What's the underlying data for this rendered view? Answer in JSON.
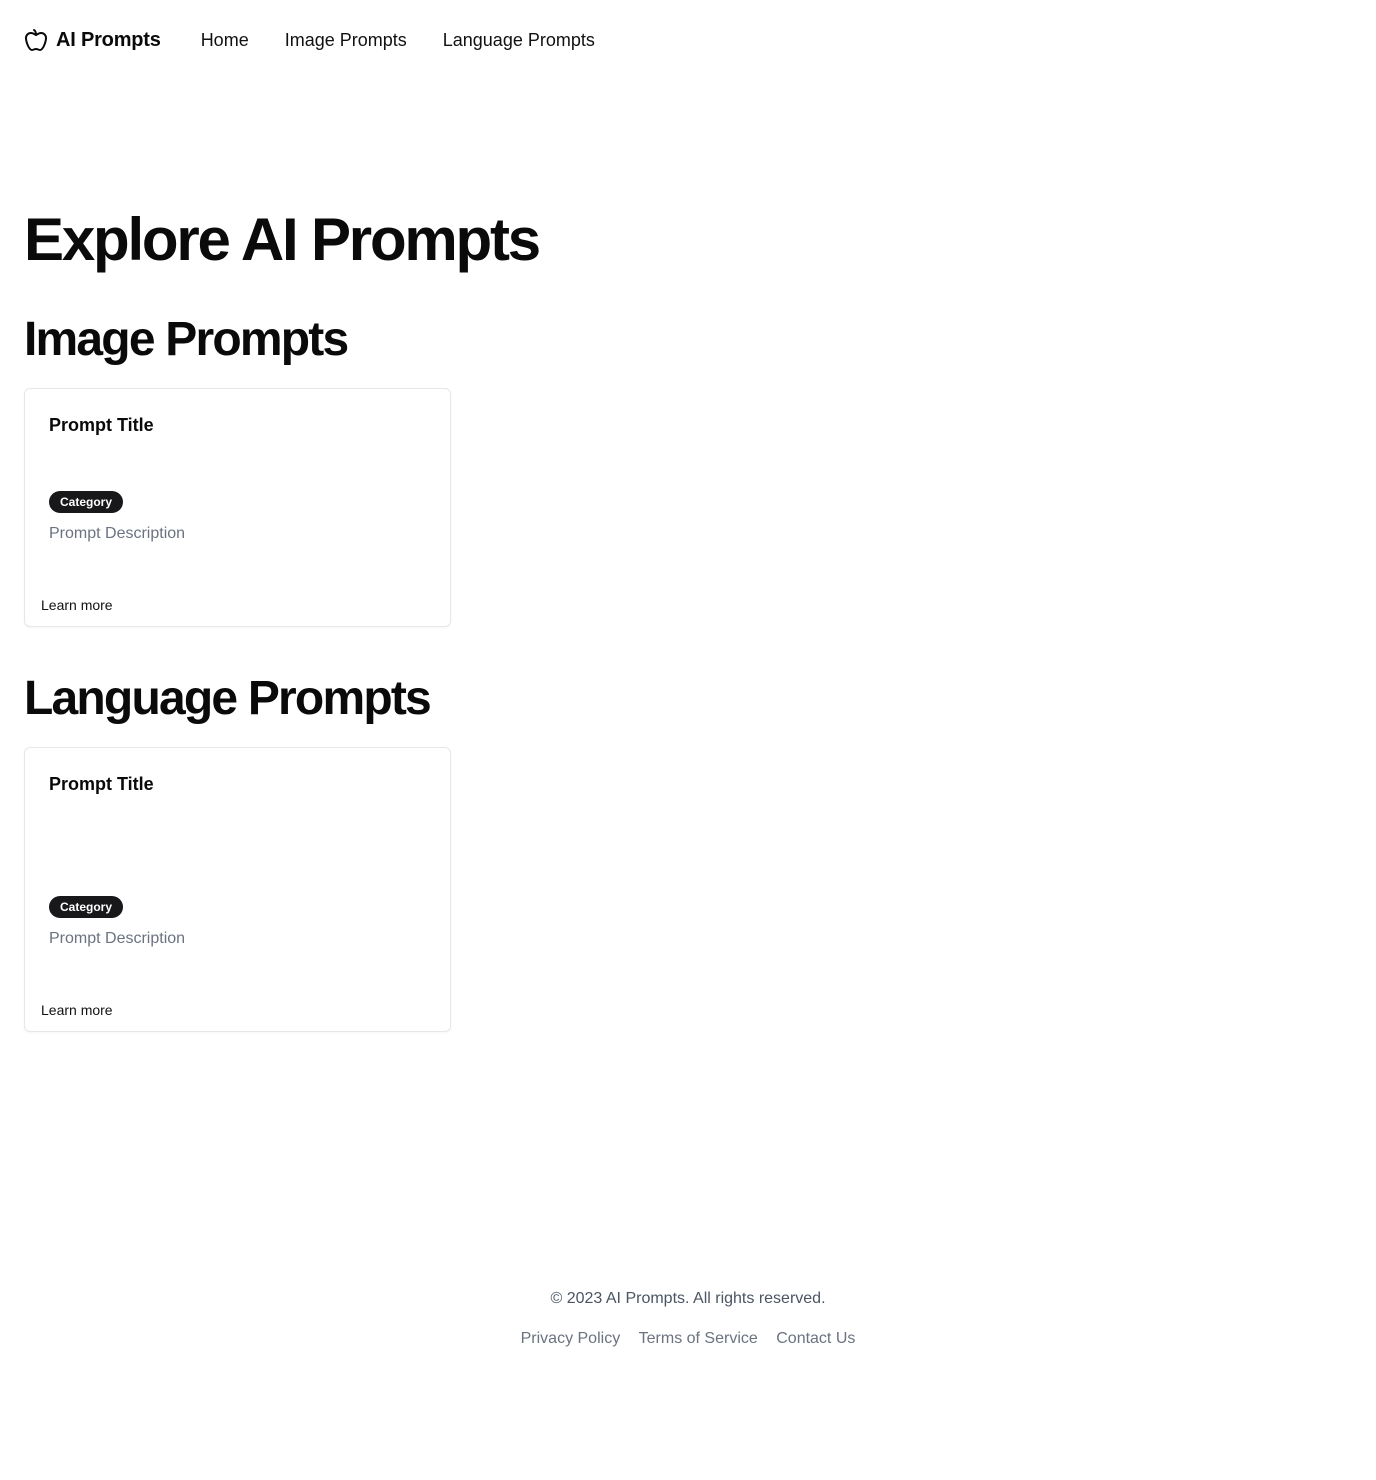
{
  "nav": {
    "brand": "AI Prompts",
    "links": [
      "Home",
      "Image Prompts",
      "Language Prompts"
    ]
  },
  "main": {
    "title": "Explore AI Prompts",
    "sections": [
      {
        "heading": "Image Prompts",
        "card": {
          "title": "Prompt Title",
          "category": "Category",
          "description": "Prompt Description",
          "action": "Learn more"
        }
      },
      {
        "heading": "Language Prompts",
        "card": {
          "title": "Prompt Title",
          "category": "Category",
          "description": "Prompt Description",
          "action": "Learn more"
        }
      }
    ]
  },
  "footer": {
    "copyright": "© 2023 AI Prompts. All rights reserved.",
    "links": [
      "Privacy Policy",
      "Terms of Service",
      "Contact Us"
    ]
  },
  "colors": {
    "badge_bg": "#18181b",
    "muted_text": "#6b7280",
    "border": "#e5e7eb"
  },
  "icons": {
    "brand": "apple-icon"
  }
}
